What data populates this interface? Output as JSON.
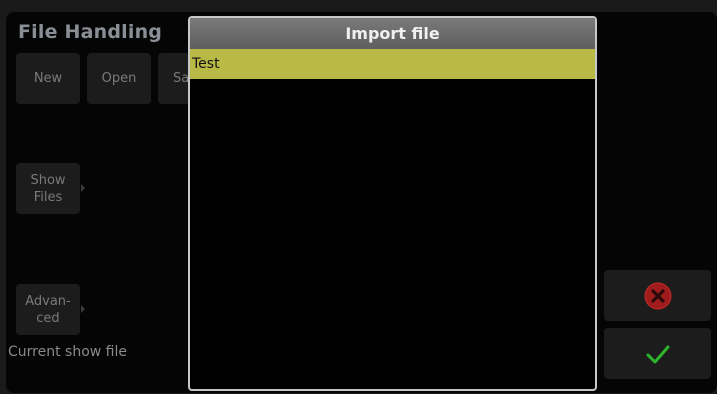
{
  "app": {
    "title": "File Handling"
  },
  "toolbar": {
    "new_label": "New",
    "open_label": "Open",
    "save_label": "Save"
  },
  "show_files": {
    "label": "Show\nFiles"
  },
  "advanced": {
    "label": "Advan-\nced"
  },
  "status": {
    "current_show_file_label": "Current show file"
  },
  "dialog": {
    "title": "Import file",
    "files": [
      {
        "name": "Test",
        "selected": true
      }
    ]
  },
  "actions": {
    "cancel_icon": "close-circle-icon",
    "confirm_icon": "checkmark-icon"
  },
  "colors": {
    "selection": "#b9b946",
    "cancel": "#a01c1c",
    "confirm": "#2cb52c"
  }
}
